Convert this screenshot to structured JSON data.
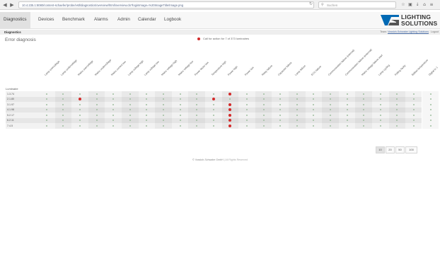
{
  "browser": {
    "url": "10.4.235.1:8080/content-schaefer/probe/vstl/diagnostics/overview/html/overview.do?loginImage=%20ImageTitle/Image.png",
    "search_placeholder": "Suchen"
  },
  "nav": {
    "items": [
      {
        "label": "Diagnostics",
        "active": true
      },
      {
        "label": "Devices"
      },
      {
        "label": "Benchmark"
      },
      {
        "label": "Alarms"
      },
      {
        "label": "Admin"
      },
      {
        "label": "Calendar"
      },
      {
        "label": "Logbook"
      }
    ]
  },
  "logo": {
    "line1": "LIGHTING",
    "line2": "SOLUTIONS",
    "color": "#0069b4"
  },
  "page": {
    "title": "Diagnostics",
    "user_prefix": "Team:",
    "user_link": "Vossloh-Schwabe Lighting Solutions",
    "logout": "Logout"
  },
  "section_title": "Error diagnosis",
  "legend_text": "Call for action for 7 of 373 luminaires",
  "table": {
    "row_header": "Luminaire",
    "columns": [
      "Lamp overvoltage",
      "Lamp undervoltage",
      "Mains overvoltage",
      "Mains undervoltage",
      "Mains current low",
      "Lamp voltage high",
      "Lamp voltage low",
      "Mains voltage high",
      "Mains voltage low",
      "Power factor low",
      "Temperature high",
      "Power high",
      "Power low",
      "Relay failure",
      "Capacitor failure",
      "Lamp failure",
      "ECG failure",
      "Communication failure (internal)",
      "Communication failure (external)",
      "Mains voltage failure start",
      "Lamp cycling",
      "Polling faulty",
      "Ballast temperature",
      "Digital in 1",
      "Digital in 2"
    ],
    "rows": [
      {
        "label": "1.3.74",
        "red": [
          11
        ]
      },
      {
        "label": "2.1.80",
        "red": [
          2,
          10
        ]
      },
      {
        "label": "3.1.97",
        "red": [
          11
        ]
      },
      {
        "label": "4.1.98",
        "red": [
          11
        ]
      },
      {
        "label": "5.2.17",
        "red": [
          11
        ]
      },
      {
        "label": "6.2.11",
        "red": [
          11
        ]
      },
      {
        "label": "7.4.5",
        "red": [
          11
        ]
      }
    ],
    "status_colors": {
      "ok": "#9fbf9f",
      "alarm": "#d32a2a"
    }
  },
  "pager": [
    "10",
    "20",
    "50",
    "100"
  ],
  "pager_active": "10",
  "footer": {
    "text": "© Vossloh-Schwabe GmbH",
    "suffix": " | All Rights Reserved"
  }
}
